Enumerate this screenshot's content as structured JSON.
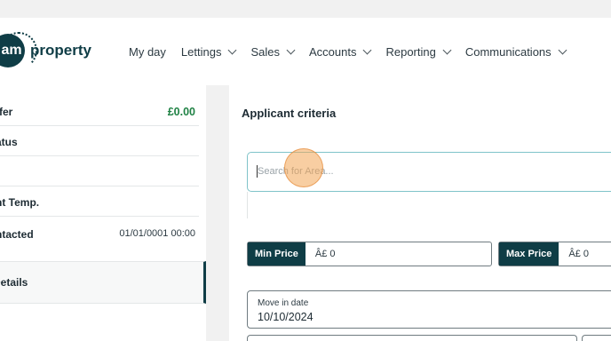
{
  "brand": {
    "logo_mark": "am",
    "logo_word": "property"
  },
  "nav": [
    {
      "label": "My day",
      "has_menu": false
    },
    {
      "label": "Lettings",
      "has_menu": true
    },
    {
      "label": "Sales",
      "has_menu": true
    },
    {
      "label": "Accounts",
      "has_menu": true
    },
    {
      "label": "Reporting",
      "has_menu": true
    },
    {
      "label": "Communications",
      "has_menu": true
    }
  ],
  "sidebar": {
    "rows": [
      {
        "label": "ffer",
        "value": "£0.00"
      },
      {
        "label": "atus",
        "value": ""
      },
      {
        "label": "",
        "value": ""
      },
      {
        "label": "nt Temp.",
        "value": ""
      },
      {
        "label": "ntacted",
        "value": "01/01/0001 00:00"
      }
    ],
    "details_label": "Details"
  },
  "main": {
    "title": "Applicant criteria",
    "search_placeholder": "Search for Area...",
    "min_price": {
      "label": "Min Price",
      "value": "Â£ 0"
    },
    "max_price": {
      "label": "Max Price",
      "value": "Â£ 0"
    },
    "move_in": {
      "label": "Move in date",
      "value": "10/10/2024"
    }
  },
  "colors": {
    "brand": "#0f3d46",
    "positive": "#208245",
    "focus": "#7fc3c9"
  }
}
